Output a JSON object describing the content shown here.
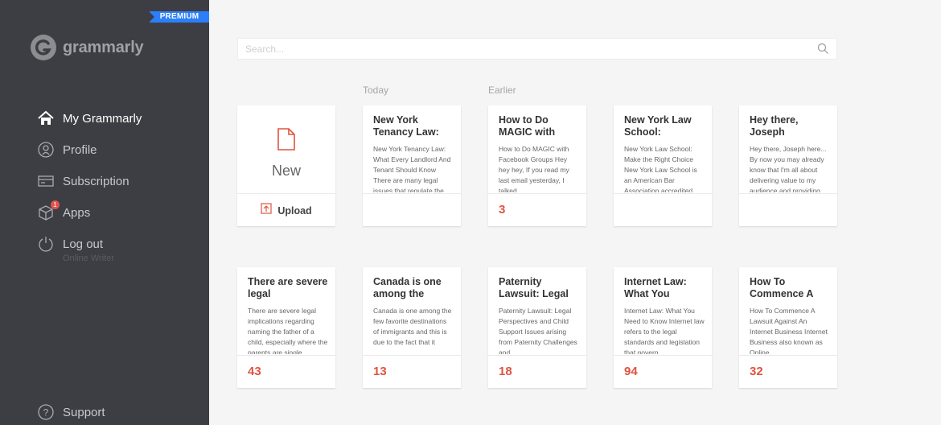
{
  "sidebar": {
    "premium_label": "PREMIUM",
    "logo_text": "grammarly",
    "items": [
      {
        "label": "My Grammarly",
        "icon": "home-icon"
      },
      {
        "label": "Profile",
        "icon": "profile-icon"
      },
      {
        "label": "Subscription",
        "icon": "card-icon"
      },
      {
        "label": "Apps",
        "icon": "box-icon",
        "badge": "1"
      },
      {
        "label": "Log out",
        "icon": "power-icon",
        "sub": "Online Writer"
      }
    ],
    "support_label": "Support"
  },
  "search": {
    "placeholder": "Search..."
  },
  "sections": {
    "today": "Today",
    "earlier": "Earlier"
  },
  "new_card": {
    "label": "New",
    "upload_label": "Upload"
  },
  "documents": [
    {
      "title": "New York Tenancy Law:",
      "body": "New York Tenancy Law: What Every Landlord And Tenant Should Know There are many legal issues that regulate the relationship between a",
      "count": ""
    },
    {
      "title": "How to Do MAGIC with",
      "body": "How to Do MAGIC with Facebook Groups Hey hey hey, If you read my last email yesterday, I talked",
      "count": "3"
    },
    {
      "title": "New York Law School:",
      "body": "New York Law School: Make the Right Choice New York Law School is an American Bar Association accredited private law school. It was established in",
      "count": ""
    },
    {
      "title": "Hey there, Joseph",
      "body": "Hey there, Joseph here... By now you may already know that I'm all about delivering value to my audience and providing solutions to your problems.",
      "count": ""
    },
    {
      "title": "There are severe legal",
      "body": "There are severe legal implications regarding naming the father of a child, especially where the parents are single",
      "count": "43"
    },
    {
      "title": "Canada is one among the",
      "body": "Canada is one among the few favorite destinations of immigrants and this is due to the fact that it",
      "count": "13"
    },
    {
      "title": "Paternity Lawsuit: Legal",
      "body": "Paternity Lawsuit: Legal Perspectives and Child Support Issues arising from Paternity Challenges and",
      "count": "18"
    },
    {
      "title": "Internet Law: What You",
      "body": "Internet Law: What You Need to Know Internet law refers to the legal standards and legislation that govern",
      "count": "94"
    },
    {
      "title": "How To Commence A",
      "body": "How To Commence A Lawsuit Against An Internet Business Internet Business also known as Online",
      "count": "32"
    }
  ],
  "colors": {
    "sidebar_bg": "#3d3e43",
    "premium_blue": "#2d7ff9",
    "accent_red": "#e0533f"
  }
}
